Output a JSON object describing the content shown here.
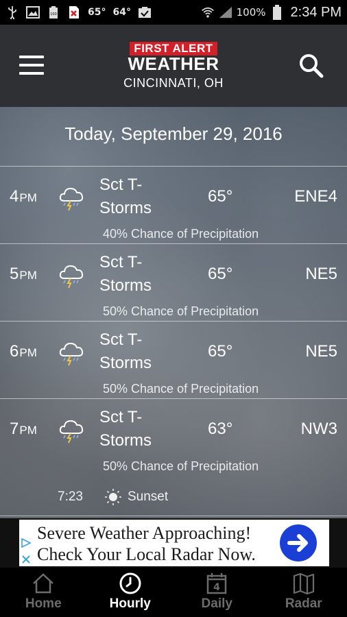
{
  "status_bar": {
    "temp_1": "65°",
    "temp_2": "64°",
    "battery": "100%",
    "time": "2:34 PM",
    "icons": [
      "usb-icon",
      "image-icon",
      "battery-full-icon",
      "error-icon",
      "clipboard-check-icon",
      "wifi-icon",
      "signal-icon",
      "battery-icon"
    ]
  },
  "header": {
    "logo_top": "FIRST ALERT",
    "logo_main": "WEATHER",
    "location": "CINCINNATI, OH",
    "brand_color": "#d31f27",
    "icons": [
      "menu-icon",
      "search-icon"
    ]
  },
  "hourly": {
    "date_title": "Today, September 29, 2016",
    "rows": [
      {
        "hour": "4",
        "ampm": "PM",
        "condition_1": "Sct T-",
        "condition_2": "Storms",
        "temp": "65°",
        "wind": "ENE4",
        "precip": "40% Chance of Precipitation",
        "icon": "thunderstorm-cloud-icon"
      },
      {
        "hour": "5",
        "ampm": "PM",
        "condition_1": "Sct T-",
        "condition_2": "Storms",
        "temp": "65°",
        "wind": "NE5",
        "precip": "50% Chance of Precipitation",
        "icon": "thunderstorm-cloud-icon"
      },
      {
        "hour": "6",
        "ampm": "PM",
        "condition_1": "Sct T-",
        "condition_2": "Storms",
        "temp": "65°",
        "wind": "NE5",
        "precip": "50% Chance of Precipitation",
        "icon": "thunderstorm-cloud-icon"
      },
      {
        "hour": "7",
        "ampm": "PM",
        "condition_1": "Sct T-",
        "condition_2": "Storms",
        "temp": "63°",
        "wind": "NW3",
        "precip": "50% Chance of Precipitation",
        "icon": "thunderstorm-cloud-icon"
      }
    ],
    "sunset": {
      "time": "7:23",
      "label": "Sunset",
      "icon": "sun-icon"
    }
  },
  "ad": {
    "line_1": "Severe Weather Approaching!",
    "line_2": "Check Your Local Radar Now.",
    "button_color": "#1a3fd6",
    "icons": [
      "arrow-right-icon",
      "ad-choices-icon"
    ]
  },
  "bottom_nav": {
    "items": [
      {
        "label": "Home",
        "icon": "home-icon",
        "active": false
      },
      {
        "label": "Hourly",
        "icon": "clock-icon",
        "active": true
      },
      {
        "label": "Daily",
        "icon": "calendar-icon",
        "badge": "4",
        "active": false
      },
      {
        "label": "Radar",
        "icon": "map-icon",
        "active": false
      }
    ]
  }
}
